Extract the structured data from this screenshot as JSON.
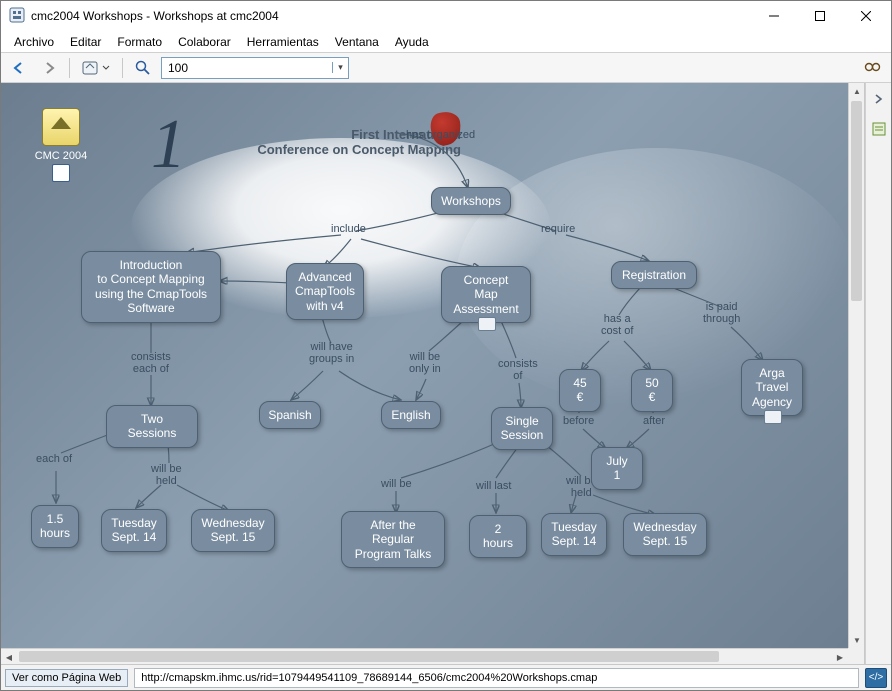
{
  "window": {
    "title": "cmc2004 Workshops - Workshops at cmc2004"
  },
  "menu": {
    "items": [
      "Archivo",
      "Editar",
      "Formato",
      "Colaborar",
      "Herramientas",
      "Ventana",
      "Ayuda"
    ]
  },
  "toolbar": {
    "back_icon": "back-arrow-icon",
    "forward_icon": "forward-arrow-icon",
    "home_icon": "home-dropdown-icon",
    "zoom_icon": "magnifier-icon",
    "zoom_value": "100",
    "right_tool_1": "binoculars-icon",
    "right_tool_2": "notes-panel-icon"
  },
  "canvas": {
    "home_label": "CMC 2004",
    "logo_line1": "First International",
    "logo_line2": "Conference on Concept Mapping",
    "nodes": {
      "workshops": "Workshops",
      "intro": "Introduction\nto Concept Mapping\nusing the CmapTools\nSoftware",
      "advanced": "Advanced\nCmapTools\nwith v4",
      "assessment": "Concept\nMap\nAssessment",
      "registration": "Registration",
      "two_sessions": "Two Sessions",
      "spanish": "Spanish",
      "english": "English",
      "single_session": "Single\nSession",
      "cost45": "45 €",
      "cost50": "50 €",
      "arga": "Arga\nTravel\nAgency",
      "july1": "July 1",
      "hours15": "1.5\nhours",
      "tue14a": "Tuesday\nSept. 14",
      "wed15a": "Wednesday\nSept. 15",
      "after_talks": "After the\nRegular\nProgram Talks",
      "hours2": "2 hours",
      "tue14b": "Tuesday\nSept. 14",
      "wed15b": "Wednesday\nSept. 15"
    },
    "links": {
      "has_organized": "has organized",
      "include": "include",
      "require": "require",
      "consists_each_of": "consists\neach of",
      "will_have_groups_in": "will have\ngroups in",
      "will_be_only_in": "will be\nonly in",
      "consists_of": "consists\nof",
      "has_a_cost_of": "has a\ncost of",
      "is_paid_through": "is paid\nthrough",
      "each_of": "each of",
      "will_be_held_a": "will be\nheld",
      "will_be": "will be",
      "will_last": "will last",
      "will_be_held_b": "will be\nheld",
      "before": "before",
      "after": "after"
    }
  },
  "status": {
    "web_button": "Ver como Página Web",
    "url": "http://cmapskm.ihmc.us/rid=1079449541109_78689144_6506/cmc2004%20Workshops.cmap",
    "code_icon": "source-view-icon"
  }
}
